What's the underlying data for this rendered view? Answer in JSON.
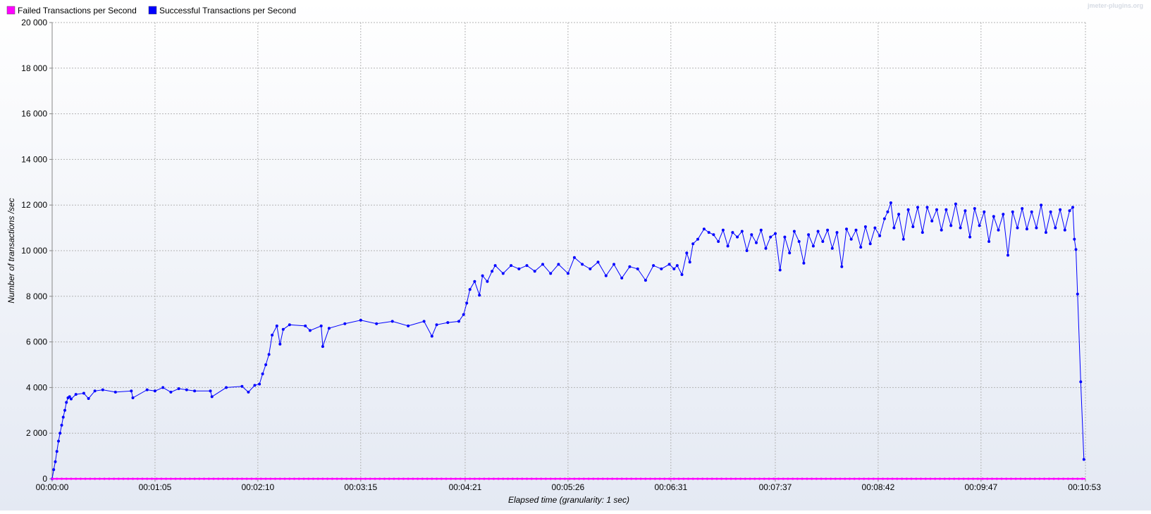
{
  "watermark": "jmeter-plugins.org",
  "chart_data": {
    "type": "line",
    "title": "",
    "xlabel": "Elapsed time (granularity: 1 sec)",
    "ylabel": "Number of transactions /sec",
    "x_range_seconds": [
      0,
      653
    ],
    "ylim": [
      0,
      20000
    ],
    "y_ticks": [
      0,
      2000,
      4000,
      6000,
      8000,
      10000,
      12000,
      14000,
      16000,
      18000,
      20000
    ],
    "y_tick_labels": [
      "0",
      "2 000",
      "4 000",
      "6 000",
      "8 000",
      "10 000",
      "12 000",
      "14 000",
      "16 000",
      "18 000",
      "20 000"
    ],
    "x_ticks_seconds": [
      0,
      65,
      130,
      195,
      261,
      326,
      391,
      457,
      522,
      587,
      653
    ],
    "x_tick_labels": [
      "00:00:00",
      "00:01:05",
      "00:02:10",
      "00:03:15",
      "00:04:21",
      "00:05:26",
      "00:06:31",
      "00:07:37",
      "00:08:42",
      "00:09:47",
      "00:10:53"
    ],
    "grid": true,
    "legend_position": "top-left",
    "series": [
      {
        "name": "Failed Transactions per Second",
        "color": "#ff00ff",
        "constant_value": 0
      },
      {
        "name": "Successful Transactions per Second",
        "color": "#0000ff",
        "points": [
          [
            0,
            0
          ],
          [
            1,
            400
          ],
          [
            2,
            750
          ],
          [
            3,
            1200
          ],
          [
            4,
            1650
          ],
          [
            5,
            2000
          ],
          [
            6,
            2350
          ],
          [
            7,
            2700
          ],
          [
            8,
            3000
          ],
          [
            9,
            3350
          ],
          [
            10,
            3550
          ],
          [
            11,
            3600
          ],
          [
            12,
            3500
          ],
          [
            15,
            3700
          ],
          [
            20,
            3750
          ],
          [
            23,
            3520
          ],
          [
            27,
            3850
          ],
          [
            32,
            3900
          ],
          [
            40,
            3800
          ],
          [
            50,
            3850
          ],
          [
            51,
            3550
          ],
          [
            60,
            3900
          ],
          [
            65,
            3850
          ],
          [
            70,
            4000
          ],
          [
            75,
            3800
          ],
          [
            80,
            3950
          ],
          [
            85,
            3900
          ],
          [
            90,
            3850
          ],
          [
            100,
            3850
          ],
          [
            101,
            3600
          ],
          [
            110,
            4000
          ],
          [
            120,
            4050
          ],
          [
            124,
            3800
          ],
          [
            128,
            4100
          ],
          [
            131,
            4150
          ],
          [
            133,
            4600
          ],
          [
            135,
            5000
          ],
          [
            137,
            5450
          ],
          [
            139,
            6300
          ],
          [
            142,
            6700
          ],
          [
            144,
            5900
          ],
          [
            146,
            6550
          ],
          [
            150,
            6750
          ],
          [
            160,
            6700
          ],
          [
            163,
            6500
          ],
          [
            170,
            6700
          ],
          [
            171,
            5800
          ],
          [
            175,
            6600
          ],
          [
            185,
            6800
          ],
          [
            195,
            6950
          ],
          [
            205,
            6800
          ],
          [
            215,
            6900
          ],
          [
            225,
            6700
          ],
          [
            235,
            6900
          ],
          [
            240,
            6250
          ],
          [
            243,
            6750
          ],
          [
            250,
            6850
          ],
          [
            257,
            6900
          ],
          [
            260,
            7200
          ],
          [
            262,
            7700
          ],
          [
            264,
            8300
          ],
          [
            267,
            8650
          ],
          [
            270,
            8050
          ],
          [
            272,
            8900
          ],
          [
            275,
            8650
          ],
          [
            278,
            9100
          ],
          [
            280,
            9350
          ],
          [
            285,
            9000
          ],
          [
            290,
            9350
          ],
          [
            295,
            9200
          ],
          [
            300,
            9350
          ],
          [
            305,
            9100
          ],
          [
            310,
            9400
          ],
          [
            315,
            9000
          ],
          [
            320,
            9400
          ],
          [
            326,
            9000
          ],
          [
            330,
            9700
          ],
          [
            335,
            9400
          ],
          [
            340,
            9200
          ],
          [
            345,
            9500
          ],
          [
            350,
            8900
          ],
          [
            355,
            9400
          ],
          [
            360,
            8800
          ],
          [
            365,
            9300
          ],
          [
            370,
            9200
          ],
          [
            375,
            8700
          ],
          [
            380,
            9350
          ],
          [
            385,
            9200
          ],
          [
            390,
            9400
          ],
          [
            393,
            9200
          ],
          [
            395,
            9350
          ],
          [
            398,
            8950
          ],
          [
            401,
            9900
          ],
          [
            403,
            9500
          ],
          [
            405,
            10300
          ],
          [
            408,
            10500
          ],
          [
            412,
            10950
          ],
          [
            415,
            10800
          ],
          [
            418,
            10700
          ],
          [
            421,
            10400
          ],
          [
            424,
            10900
          ],
          [
            427,
            10200
          ],
          [
            430,
            10800
          ],
          [
            433,
            10600
          ],
          [
            436,
            10850
          ],
          [
            439,
            10000
          ],
          [
            442,
            10700
          ],
          [
            445,
            10350
          ],
          [
            448,
            10900
          ],
          [
            451,
            10100
          ],
          [
            454,
            10600
          ],
          [
            457,
            10750
          ],
          [
            460,
            9150
          ],
          [
            463,
            10600
          ],
          [
            466,
            9900
          ],
          [
            469,
            10850
          ],
          [
            472,
            10400
          ],
          [
            475,
            9450
          ],
          [
            478,
            10700
          ],
          [
            481,
            10200
          ],
          [
            484,
            10850
          ],
          [
            487,
            10400
          ],
          [
            490,
            10900
          ],
          [
            493,
            10100
          ],
          [
            496,
            10800
          ],
          [
            499,
            9300
          ],
          [
            502,
            10950
          ],
          [
            505,
            10500
          ],
          [
            508,
            10900
          ],
          [
            511,
            10150
          ],
          [
            514,
            11050
          ],
          [
            517,
            10300
          ],
          [
            520,
            11000
          ],
          [
            523,
            10650
          ],
          [
            526,
            11400
          ],
          [
            528,
            11700
          ],
          [
            530,
            12100
          ],
          [
            532,
            11000
          ],
          [
            535,
            11600
          ],
          [
            538,
            10500
          ],
          [
            541,
            11800
          ],
          [
            544,
            11050
          ],
          [
            547,
            11900
          ],
          [
            550,
            10800
          ],
          [
            553,
            11900
          ],
          [
            556,
            11300
          ],
          [
            559,
            11800
          ],
          [
            562,
            10900
          ],
          [
            565,
            11800
          ],
          [
            568,
            11100
          ],
          [
            571,
            12050
          ],
          [
            574,
            11000
          ],
          [
            577,
            11750
          ],
          [
            580,
            10600
          ],
          [
            583,
            11850
          ],
          [
            586,
            11100
          ],
          [
            589,
            11700
          ],
          [
            592,
            10400
          ],
          [
            595,
            11500
          ],
          [
            598,
            10900
          ],
          [
            601,
            11600
          ],
          [
            604,
            9800
          ],
          [
            607,
            11700
          ],
          [
            610,
            11000
          ],
          [
            613,
            11850
          ],
          [
            616,
            10950
          ],
          [
            619,
            11700
          ],
          [
            622,
            11000
          ],
          [
            625,
            12000
          ],
          [
            628,
            10800
          ],
          [
            631,
            11700
          ],
          [
            634,
            11000
          ],
          [
            637,
            11800
          ],
          [
            640,
            10900
          ],
          [
            643,
            11750
          ],
          [
            645,
            11900
          ],
          [
            646,
            10500
          ],
          [
            647,
            10050
          ],
          [
            648,
            8100
          ],
          [
            650,
            4250
          ],
          [
            652,
            850
          ]
        ]
      }
    ]
  }
}
